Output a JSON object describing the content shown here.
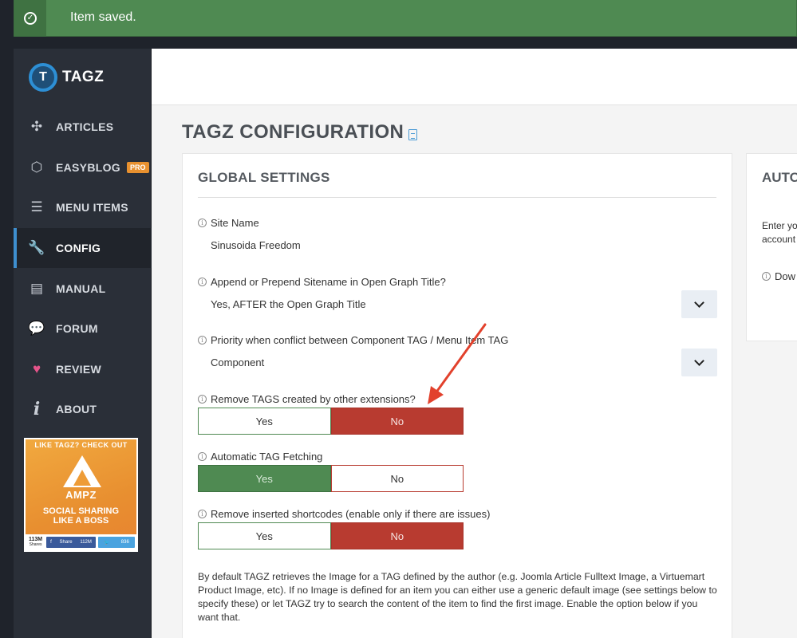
{
  "notification": {
    "message": "Item saved."
  },
  "logo": {
    "mark": "T",
    "text": "TAGZ"
  },
  "nav": [
    {
      "label": "ARTICLES",
      "icon": "joomla-icon",
      "glyph": "✣"
    },
    {
      "label": "EASYBLOG",
      "icon": "easyblog-icon",
      "glyph": "⬡",
      "badge": "PRO"
    },
    {
      "label": "MENU ITEMS",
      "icon": "menu-icon",
      "glyph": "☰"
    },
    {
      "label": "CONFIG",
      "icon": "wrench-icon",
      "glyph": "🔧"
    },
    {
      "label": "MANUAL",
      "icon": "document-icon",
      "glyph": "▤"
    },
    {
      "label": "FORUM",
      "icon": "chat-bubbles-icon",
      "glyph": "💬"
    },
    {
      "label": "REVIEW",
      "icon": "heart-icon",
      "glyph": "♥"
    },
    {
      "label": "ABOUT",
      "icon": "info-icon",
      "glyph": "i"
    }
  ],
  "promo": {
    "heading": "LIKE TAGZ? CHECK OUT",
    "brand": "AMPZ",
    "tagline_1": "SOCIAL SHARING",
    "tagline_2": "LIKE A BOSS",
    "count": "113M",
    "count_label": "Shares",
    "fb_label": "Share",
    "fb_count": "112M",
    "tw_count": "836"
  },
  "page": {
    "title": "TAGZ CONFIGURATION"
  },
  "global_settings": {
    "title": "GLOBAL SETTINGS",
    "site_name_label": "Site Name",
    "site_name_value": "Sinusoida Freedom",
    "append_label": "Append or Prepend Sitename in Open Graph Title?",
    "append_value": "Yes, AFTER the Open Graph Title",
    "priority_label": "Priority when conflict between Component TAG / Menu Item TAG",
    "priority_value": "Component",
    "remove_tags_label": "Remove TAGS created by other extensions?",
    "auto_fetch_label": "Automatic TAG Fetching",
    "remove_shortcodes_label": "Remove inserted shortcodes (enable only if there are issues)",
    "yes": "Yes",
    "no": "No",
    "description": "By default TAGZ retrieves the Image for a TAG defined by the author (e.g. Joomla Article Fulltext Image, a Virtuemart Product Image, etc). If no Image is defined for an item you can either use a generic default image (see settings below to specify these) or let TAGZ try to search the content of the item to find the first image. Enable the option below if you want that."
  },
  "side_card": {
    "title": "AUTO",
    "text_1": "Enter yo",
    "text_2": "account",
    "label": "Dow"
  },
  "colors": {
    "success": "#4f8a52",
    "danger": "#b83b30",
    "accent": "#3e8fd0",
    "sidebar": "#2a2f38"
  }
}
